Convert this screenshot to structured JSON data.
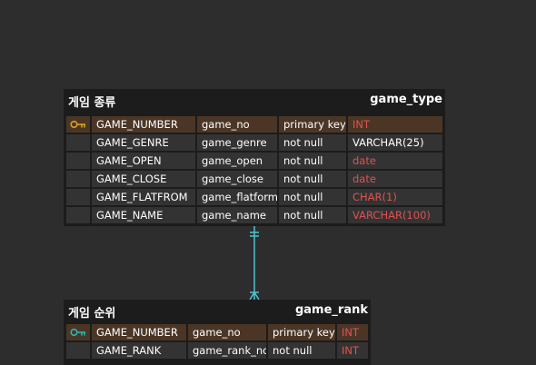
{
  "colors": {
    "background": "#2d2d2d",
    "entity_bg": "#1c1c1c",
    "cell_bg": "#333333",
    "pk_row_bg": "#4b3625",
    "type_red": "#e05252",
    "connector": "#4fc3d1",
    "key_gold": "#d9a01e",
    "key_teal": "#2bb5b0"
  },
  "entities": [
    {
      "title": "게임 종류",
      "name": "game_type",
      "key_icon": "key-icon-gold",
      "rows": [
        {
          "pk": true,
          "logical": "GAME_NUMBER",
          "physical": "game_no",
          "constraint": "primary key",
          "type": "INT",
          "type_color": "red"
        },
        {
          "pk": false,
          "logical": "GAME_GENRE",
          "physical": "game_genre",
          "constraint": "not null",
          "type": "VARCHAR(25)",
          "type_color": "white"
        },
        {
          "pk": false,
          "logical": "GAME_OPEN",
          "physical": "game_open",
          "constraint": "not null",
          "type": "date",
          "type_color": "red"
        },
        {
          "pk": false,
          "logical": "GAME_CLOSE",
          "physical": "game_close",
          "constraint": "not null",
          "type": "date",
          "type_color": "red"
        },
        {
          "pk": false,
          "logical": "GAME_FLATFROM",
          "physical": "game_flatform",
          "constraint": "not null",
          "type": "CHAR(1)",
          "type_color": "red"
        },
        {
          "pk": false,
          "logical": "GAME_NAME",
          "physical": "game_name",
          "constraint": "not null",
          "type": "VARCHAR(100)",
          "type_color": "red"
        }
      ]
    },
    {
      "title": "게임 순위",
      "name": "game_rank",
      "key_icon": "key-icon-teal",
      "rows": [
        {
          "pk": true,
          "logical": "GAME_NUMBER",
          "physical": "game_no",
          "constraint": "primary key",
          "type": "INT",
          "type_color": "red"
        },
        {
          "pk": false,
          "logical": "GAME_RANK",
          "physical": "game_rank_no",
          "constraint": "not null",
          "type": "INT",
          "type_color": "red"
        }
      ]
    }
  ],
  "relationship": {
    "from": "game_type",
    "to": "game_rank",
    "from_cardinality": "one-and-only-one",
    "to_cardinality": "one-or-many"
  }
}
